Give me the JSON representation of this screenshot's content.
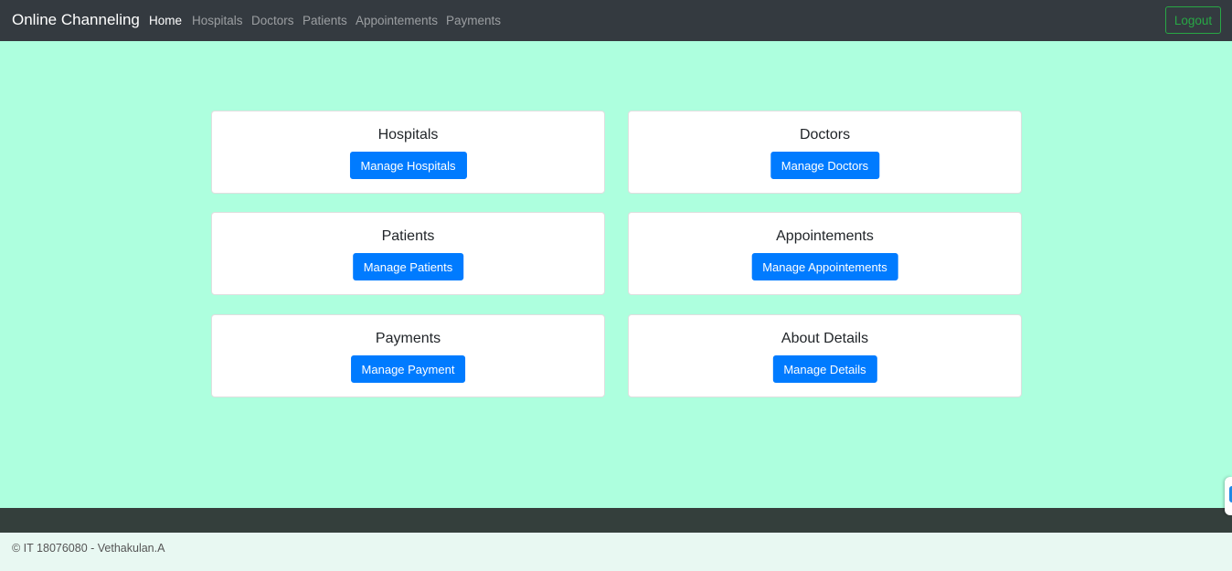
{
  "navbar": {
    "brand": "Online Channeling",
    "links": [
      "Home",
      "Hospitals",
      "Doctors",
      "Patients",
      "Appointements",
      "Payments"
    ],
    "active": "Home",
    "logout_label": "Logout"
  },
  "cards": [
    {
      "title": "Hospitals",
      "button": "Manage Hospitals"
    },
    {
      "title": "Doctors",
      "button": "Manage Doctors"
    },
    {
      "title": "Patients",
      "button": "Manage Patients"
    },
    {
      "title": "Appointements",
      "button": "Manage Appointements"
    },
    {
      "title": "Payments",
      "button": "Manage Payment"
    },
    {
      "title": "About Details",
      "button": "Manage Details"
    }
  ],
  "footer": {
    "text": "© IT 18076080 - Vethakulan.A"
  },
  "colors": {
    "navbar_bg": "#343a40",
    "main_bg": "#adffde",
    "primary_button": "#007bff",
    "logout_outline": "#28a745",
    "footer_band": "#343f3c",
    "footer_bg": "#e8f8f2"
  },
  "icons": {
    "side_widget": "side-widget-icon"
  }
}
